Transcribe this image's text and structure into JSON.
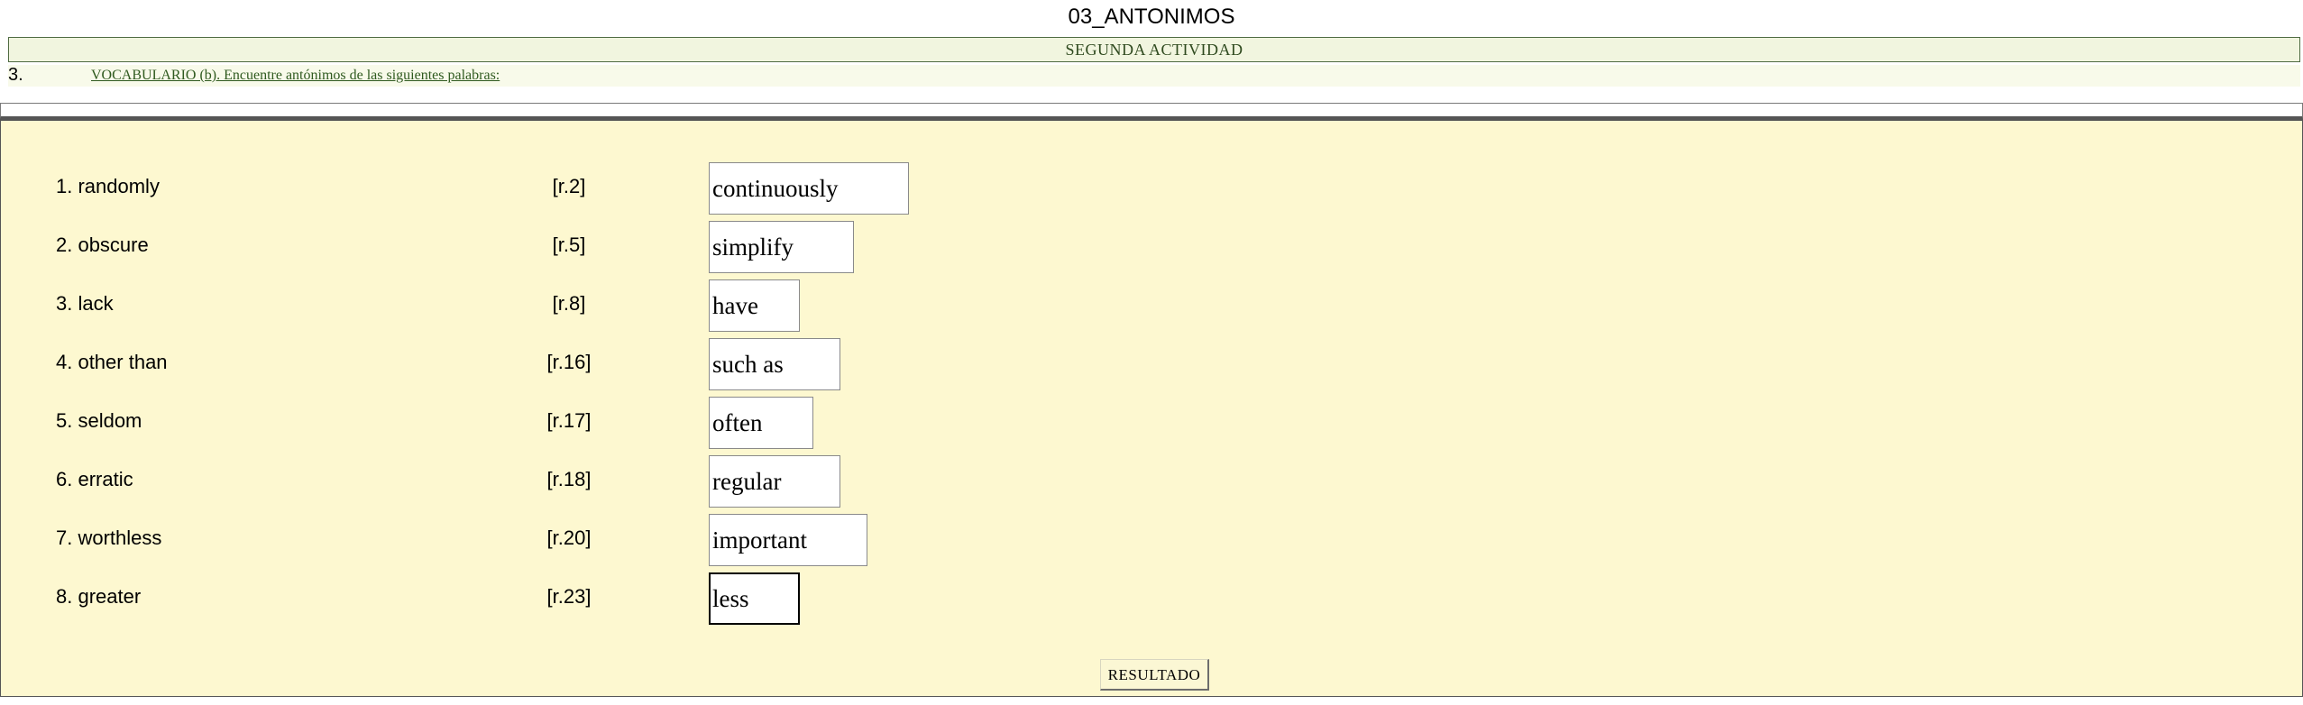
{
  "page_title": "03_ANTONIMOS",
  "activity": {
    "title": "SEGUNDA ACTIVIDAD"
  },
  "exercise": {
    "number": "3.",
    "instruction": "VOCABULARIO (b). Encuentre antónimos de las siguientes palabras:",
    "items": [
      {
        "term": "1. randomly",
        "ref": "[r.2]",
        "answer": "continuously"
      },
      {
        "term": "2. obscure",
        "ref": "[r.5]",
        "answer": "simplify"
      },
      {
        "term": "3. lack",
        "ref": "[r.8]",
        "answer": "have"
      },
      {
        "term": "4. other than",
        "ref": "[r.16]",
        "answer": "such as"
      },
      {
        "term": "5. seldom",
        "ref": "[r.17]",
        "answer": "often"
      },
      {
        "term": "6. erratic",
        "ref": "[r.18]",
        "answer": "regular"
      },
      {
        "term": "7. worthless",
        "ref": "[r.20]",
        "answer": "important"
      },
      {
        "term": "8. greater",
        "ref": "[r.23]",
        "answer": "less"
      }
    ],
    "result_button_label": "RESULTADO"
  },
  "colors": {
    "panel_background": "#fdf8d0",
    "activity_bar_background": "#f1f5df",
    "instruction_text": "#2f5a1f"
  }
}
